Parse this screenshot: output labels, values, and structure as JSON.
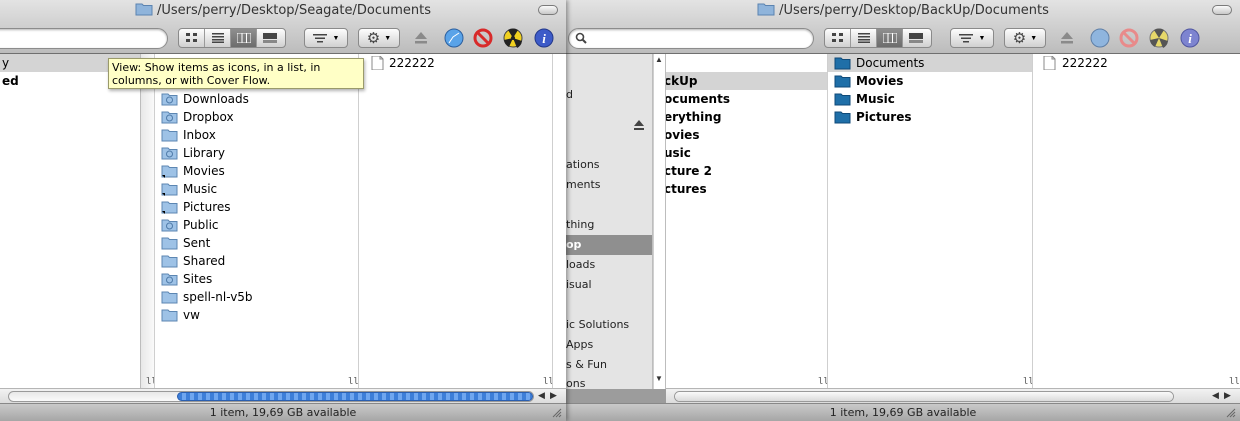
{
  "left_window": {
    "title": "/Users/perry/Desktop/Seagate/Documents",
    "tooltip": "View: Show items as icons, in a list, in columns, or with Cover Flow.",
    "col1_items": [
      "y",
      "ed"
    ],
    "col2_items": [
      {
        "label": "Downloads",
        "icon": "downloads-folder"
      },
      {
        "label": "Dropbox",
        "icon": "dropbox-folder"
      },
      {
        "label": "Inbox",
        "icon": "folder"
      },
      {
        "label": "Library",
        "icon": "library-folder"
      },
      {
        "label": "Movies",
        "icon": "alias-folder"
      },
      {
        "label": "Music",
        "icon": "alias-folder"
      },
      {
        "label": "Pictures",
        "icon": "alias-folder"
      },
      {
        "label": "Public",
        "icon": "public-folder"
      },
      {
        "label": "Sent",
        "icon": "folder"
      },
      {
        "label": "Shared",
        "icon": "folder"
      },
      {
        "label": "Sites",
        "icon": "sites-folder"
      },
      {
        "label": "spell-nl-v5b",
        "icon": "folder"
      },
      {
        "label": "vw",
        "icon": "folder"
      }
    ],
    "col3_items": [
      {
        "label": "222222",
        "icon": "document"
      }
    ],
    "status": "1 item, 19,69 GB available"
  },
  "right_window": {
    "title": "/Users/perry/Desktop/BackUp/Documents",
    "sidebar_items": [
      {
        "label": "d",
        "selected": false
      },
      {
        "label": "ations",
        "selected": false
      },
      {
        "label": "ments",
        "selected": false
      },
      {
        "label": "thing",
        "selected": false
      },
      {
        "label": "op",
        "selected": true
      },
      {
        "label": "loads",
        "selected": false
      },
      {
        "label": "isual",
        "selected": false
      },
      {
        "label": "ic Solutions",
        "selected": false
      },
      {
        "label": "Apps",
        "selected": false
      },
      {
        "label": "s & Fun",
        "selected": false
      },
      {
        "label": "ons",
        "selected": false
      }
    ],
    "col1_items": [
      {
        "label": "ckUp",
        "selected": true
      },
      {
        "label": "ocuments",
        "selected": false
      },
      {
        "label": "erything",
        "selected": false
      },
      {
        "label": "ovies",
        "selected": false
      },
      {
        "label": "usic",
        "selected": false
      },
      {
        "label": "cture 2",
        "selected": false
      },
      {
        "label": "ctures",
        "selected": false
      }
    ],
    "col2_items": [
      {
        "label": "Documents",
        "selected": true
      },
      {
        "label": "Movies",
        "selected": false
      },
      {
        "label": "Music",
        "selected": false
      },
      {
        "label": "Pictures",
        "selected": false
      }
    ],
    "col3_items": [
      {
        "label": "222222",
        "icon": "document"
      }
    ],
    "status": "1 item, 19,69 GB available"
  },
  "colors": {
    "selection_gray": "#d4d4d4",
    "sidebar_selected": "#8f8f8f",
    "tooltip_bg": "#ffffc6",
    "scroll_blue": "#3d7ed8"
  }
}
